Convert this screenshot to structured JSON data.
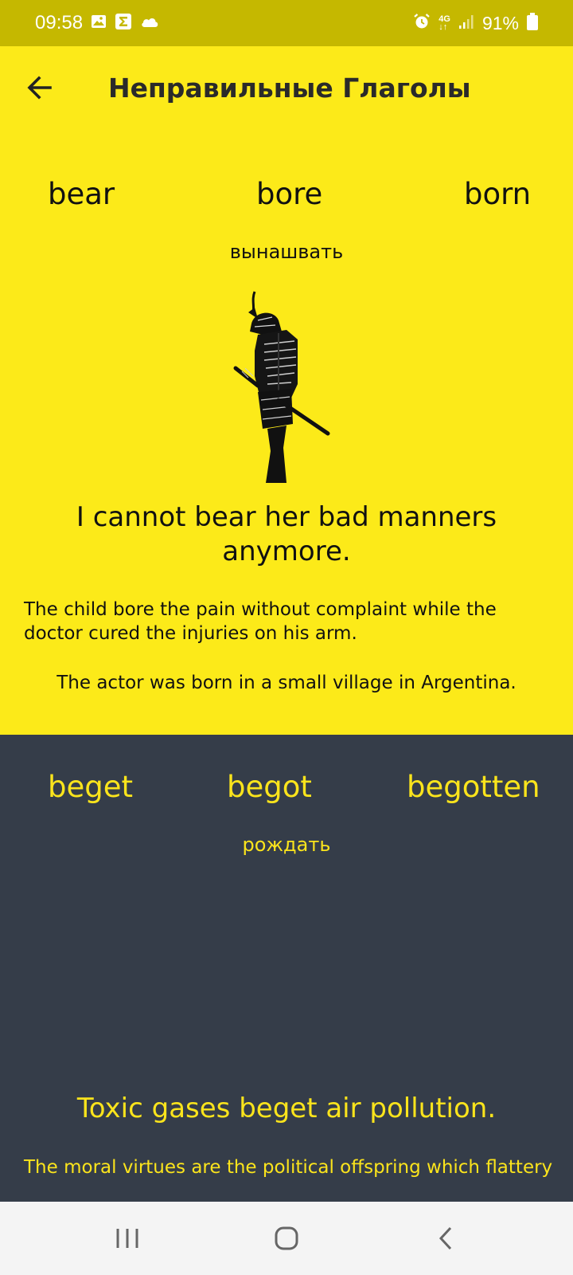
{
  "status_bar": {
    "time": "09:58",
    "network": "4G",
    "battery": "91%",
    "icons": [
      "image-icon",
      "sigma-icon",
      "cloud-icon",
      "alarm-icon",
      "network-4g-icon",
      "signal-icon",
      "battery-icon"
    ]
  },
  "app_bar": {
    "title": "Неправильные Глаголы",
    "back_icon": "arrow-left-icon"
  },
  "colors": {
    "status_bar": "#c5b800",
    "accent_yellow": "#fcea19",
    "dark_card": "#353d49",
    "dark_card_text": "#fbe41c"
  },
  "verbs": [
    {
      "base": "bear",
      "past": "bore",
      "participle": "born",
      "translation": "вынашвать",
      "example_main": "I cannot bear her bad manners anymore.",
      "example_past": "The child bore the pain without complaint while the doctor cured the injuries on his arm.",
      "example_participle": "The actor was born in a small village in Argentina."
    },
    {
      "base": "beget",
      "past": "begot",
      "participle": "begotten",
      "translation": "рождать",
      "example_main": "Toxic gases beget air pollution.",
      "example_past": "The moral virtues are the political offspring which flattery"
    }
  ],
  "nav_bar": {
    "icons": [
      "recent-apps-icon",
      "home-icon",
      "back-icon"
    ]
  }
}
